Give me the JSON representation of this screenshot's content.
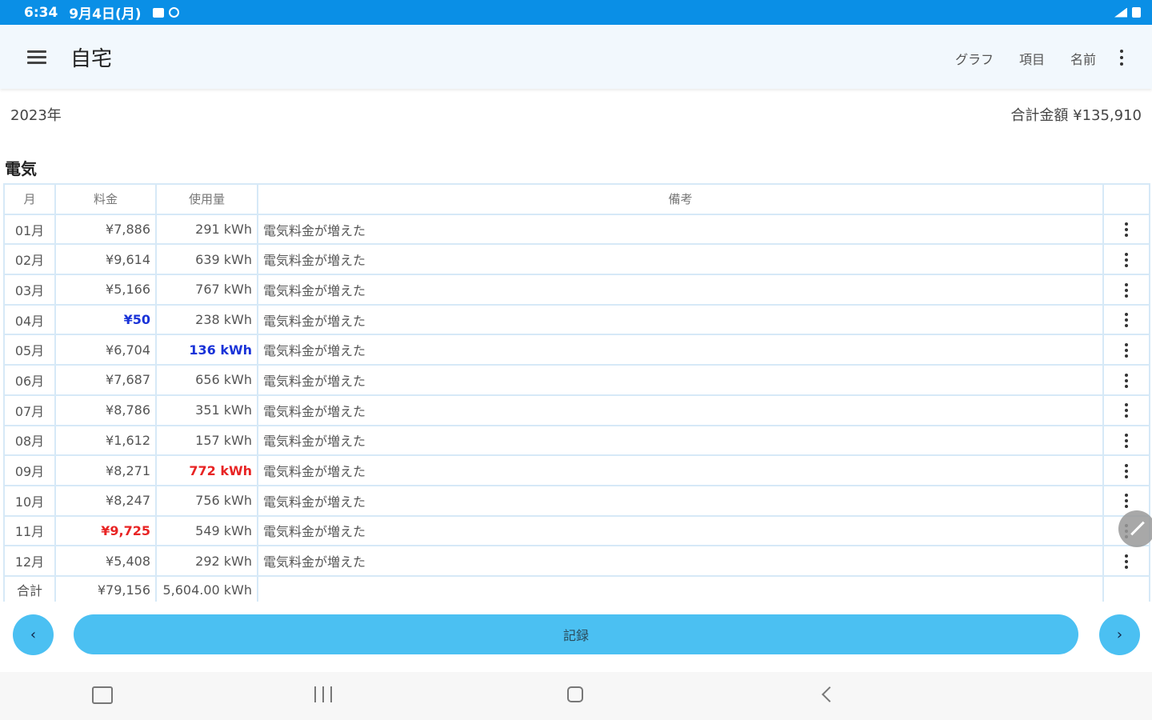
{
  "status_bar": {
    "time": "6:34",
    "date": "9月4日(月)"
  },
  "app_bar": {
    "title": "自宅",
    "actions": [
      "グラフ",
      "項目",
      "名前"
    ]
  },
  "summary": {
    "year": "2023年",
    "total": "合計金額 ¥135,910"
  },
  "section": {
    "title": "電気"
  },
  "table": {
    "headers": [
      "月",
      "料金",
      "使用量",
      "備考"
    ],
    "rows": [
      {
        "month": "01月",
        "fee": "¥7,886",
        "usage": "291 kWh",
        "note": "電気料金が増えた"
      },
      {
        "month": "02月",
        "fee": "¥9,614",
        "usage": "639 kWh",
        "note": "電気料金が増えた"
      },
      {
        "month": "03月",
        "fee": "¥5,166",
        "usage": "767 kWh",
        "note": "電気料金が増えた"
      },
      {
        "month": "04月",
        "fee": "¥50",
        "usage": "238 kWh",
        "note": "電気料金が増えた"
      },
      {
        "month": "05月",
        "fee": "¥6,704",
        "usage": "136 kWh",
        "note": "電気料金が増えた"
      },
      {
        "month": "06月",
        "fee": "¥7,687",
        "usage": "656 kWh",
        "note": "電気料金が増えた"
      },
      {
        "month": "07月",
        "fee": "¥8,786",
        "usage": "351 kWh",
        "note": "電気料金が増えた"
      },
      {
        "month": "08月",
        "fee": "¥1,612",
        "usage": "157 kWh",
        "note": "電気料金が増えた"
      },
      {
        "month": "09月",
        "fee": "¥8,271",
        "usage": "772 kWh",
        "note": "電気料金が増えた"
      },
      {
        "month": "10月",
        "fee": "¥8,247",
        "usage": "756 kWh",
        "note": "電気料金が増えた"
      },
      {
        "month": "11月",
        "fee": "¥9,725",
        "usage": "549 kWh",
        "note": "電気料金が増えた"
      },
      {
        "month": "12月",
        "fee": "¥5,408",
        "usage": "292 kWh",
        "note": "電気料金が増えた"
      }
    ],
    "totals": {
      "label": "合計",
      "fee": "¥79,156",
      "usage": "5,604.00 kWh"
    }
  },
  "footer": {
    "record_label": "記録",
    "prev_glyph": "‹",
    "next_glyph": "›"
  },
  "colors": {
    "status_bar": "#0a8fe6",
    "accent": "#4bc0f2",
    "min_highlight": "#1a33d8",
    "max_highlight": "#e82424",
    "grid": "#d6e9f7"
  },
  "icons": [
    "menu-icon",
    "more-vert-icon",
    "edit-icon",
    "keyboard-icon",
    "recents-icon",
    "home-icon",
    "back-icon"
  ]
}
